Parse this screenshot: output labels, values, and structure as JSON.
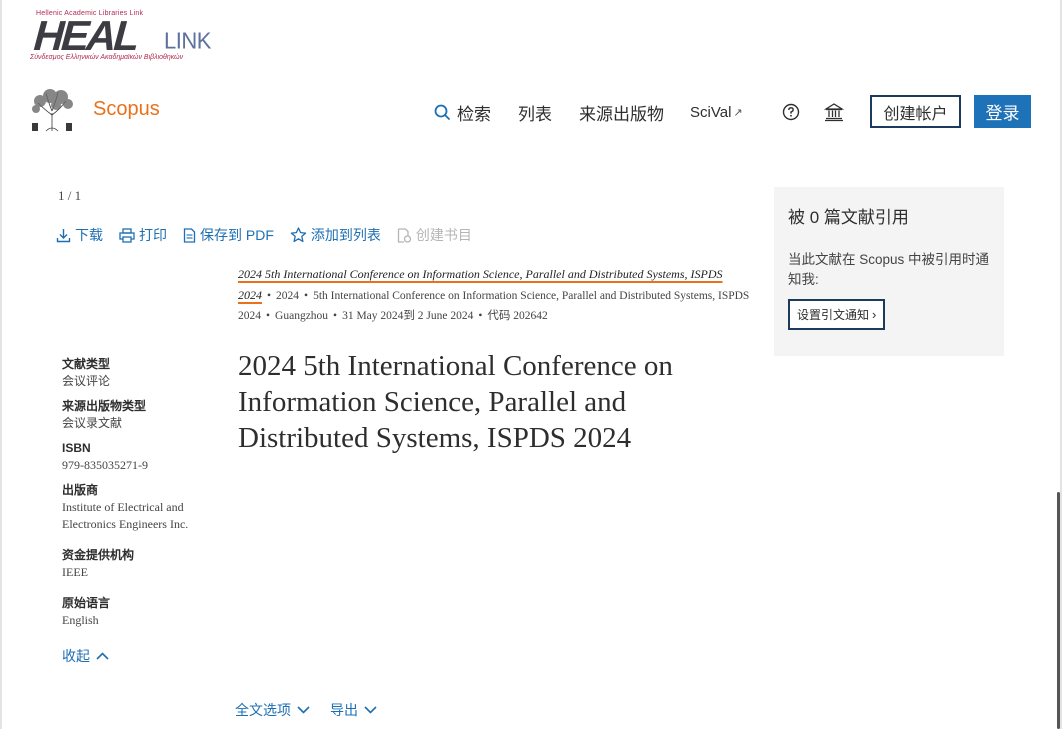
{
  "heal": {
    "top_line": "Hellenic Academic Libraries Link",
    "main": "HEAL",
    "link": "LINK",
    "bottom_line": "Σύνδεσμος Ελληνικών Ακαδημαϊκών Βιβλιοθηκών"
  },
  "header": {
    "brand": "Scopus",
    "nav": {
      "search": "检索",
      "lists": "列表",
      "sources": "来源出版物",
      "scival": "SciVal",
      "scival_arrow": "↗"
    },
    "create_account": "创建帐户",
    "login": "登录"
  },
  "toolbar": {
    "pager": "1 / 1",
    "download": "下载",
    "print": "打印",
    "save_pdf": "保存到 PDF",
    "add_list": "添加到列表",
    "create_bib": "创建书目"
  },
  "source": {
    "title": "2024 5th International Conference on Information Science, Parallel and Distributed Systems, ISPDS 2024",
    "year": "2024",
    "conference": "5th International Conference on Information Science, Parallel and Distributed Systems, ISPDS 2024",
    "location": "Guangzhou",
    "dates": "31 May 2024到 2 June 2024",
    "code": "代码 202642"
  },
  "document": {
    "title": "2024 5th International Conference on Information Science, Parallel and Distributed Systems, ISPDS 2024"
  },
  "meta": {
    "doc_type_label": "文献类型",
    "doc_type": "会议评论",
    "source_type_label": "来源出版物类型",
    "source_type": "会议录文献",
    "isbn_label": "ISBN",
    "isbn": "979-835035271-9",
    "publisher_label": "出版商",
    "publisher": "Institute of Electrical and Electronics Engineers Inc.",
    "funding_label": "资金提供机构",
    "funding": "IEEE",
    "language_label": "原始语言",
    "language": "English",
    "collapse": "收起"
  },
  "bottom": {
    "full_text": "全文选项",
    "export": "导出"
  },
  "citations": {
    "title": "被 0 篇文献引用",
    "text": "当此文献在 Scopus 中被引用时通知我:",
    "button": "设置引文通知",
    "button_arrow": "›"
  },
  "colors": {
    "accent_blue": "#1e72b8",
    "link_blue": "#1d6fb3",
    "scopus_orange": "#e9711c",
    "dark_border": "#1b3a5c"
  }
}
